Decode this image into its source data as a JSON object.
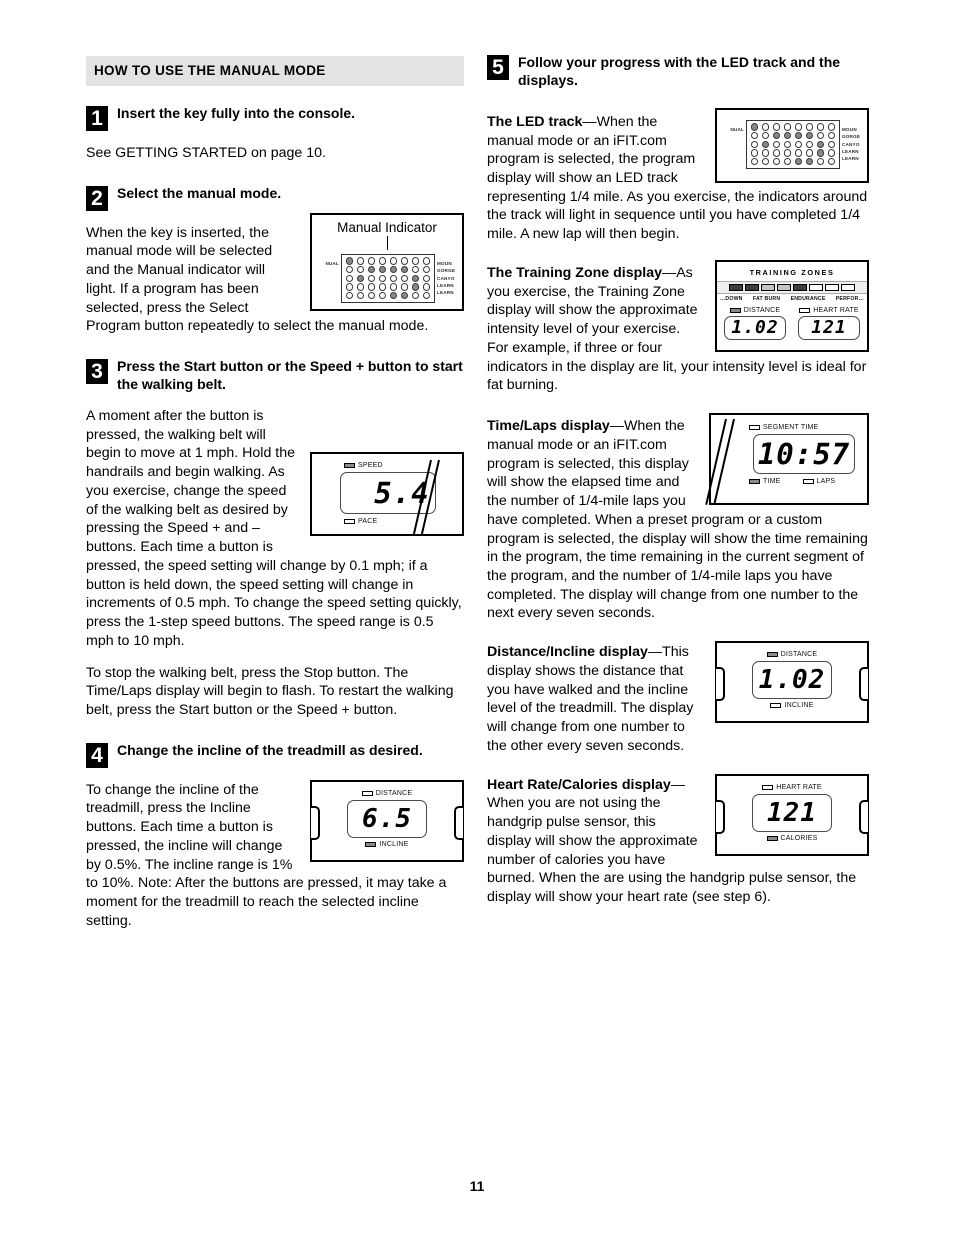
{
  "page": {
    "number": "11"
  },
  "left": {
    "section_header": "HOW TO USE THE MANUAL MODE",
    "steps": [
      {
        "num": "1",
        "title": "Insert the key fully into the console.",
        "paragraphs": [
          "See GETTING STARTED on page 10."
        ]
      },
      {
        "num": "2",
        "title": "Select the manual mode.",
        "paragraphs": [
          "When the key is inserted, the manual mode will be selected and the Manual indicator will light. If a program has been selected, press the Select Program button repeatedly to select the manual mode."
        ]
      },
      {
        "num": "3",
        "title": "Press the Start button or the Speed + button to start the walking belt.",
        "paragraphs": [
          "A moment after the button is pressed, the walking belt will begin to move at 1 mph. Hold the handrails and begin walking. As you exercise, change the speed of the walking belt as desired by pressing the Speed + and – buttons. Each time a button is pressed, the speed setting will change by 0.1 mph; if a button is held down, the speed setting will change in increments of 0.5 mph. To change the speed setting quickly, press the 1-step speed buttons. The speed range is 0.5 mph to 10 mph.",
          "To stop the walking belt, press the Stop button. The Time/Laps display will begin to flash. To restart the walking belt, press the Start button or the Speed + button."
        ]
      },
      {
        "num": "4",
        "title": "Change the incline of the treadmill as desired.",
        "paragraphs": [
          "To change the incline of the treadmill, press the Incline buttons. Each time a button is pressed, the incline will change by 0.5%. The incline range is 1% to 10%. Note: After the buttons are pressed, it may take a moment for the treadmill to reach the selected incline setting."
        ]
      }
    ]
  },
  "right": {
    "step": {
      "num": "5",
      "title": "Follow your progress with the LED track and the displays."
    },
    "blocks": [
      {
        "lead": "The LED track",
        "dash": "—",
        "text": "When the manual mode or an iFIT.com program is selected, the program display will show an LED track representing 1/4 mile. As you exercise, the indicators around the track will light in sequence until you have completed 1/4 mile. A new lap will then begin."
      },
      {
        "lead": "The Training Zone display",
        "dash": "—",
        "text": "As you exercise, the Training Zone display will show the approximate intensity level of your exercise. For example, if three or four indicators in the display are lit, your intensity level is ideal for fat burning."
      },
      {
        "lead": "Time/Laps display",
        "dash": "—",
        "text": "When the manual mode or an iFIT.com program is selected, this display will show the elapsed time and the number of 1/4-mile laps you have completed. When a preset program or a custom program is selected, the display will show the time remaining in the program, the time remaining in the current segment of the program, and the number of 1/4-mile laps you have completed. The display will change from one number to the next every seven seconds."
      },
      {
        "lead": "Distance/Incline display",
        "dash": "—",
        "text": "This display shows the distance that you have walked and the incline level of the treadmill. The display will change from one number to the other every seven seconds."
      },
      {
        "lead": "Heart Rate/Calories display",
        "dash": "—",
        "text": "When you are not using the handgrip pulse sensor, this display will show the approximate number of calories you have burned. When the are using the handgrip pulse sensor, the display will show your heart rate (see step 6)."
      }
    ]
  },
  "figures": {
    "led_track": {
      "caption": "Manual Indicator",
      "left_labels": [
        "NUAL",
        "",
        "",
        "",
        ""
      ],
      "right_labels": [
        "MOUN",
        "GORGE",
        "CANYO",
        "LEARN",
        "LEARN"
      ],
      "rows": 5,
      "cols": 8,
      "lit": [
        [
          1,
          0,
          0,
          0,
          0,
          0,
          0,
          0
        ],
        [
          0,
          0,
          1,
          1,
          1,
          1,
          0,
          0
        ],
        [
          0,
          1,
          0,
          0,
          0,
          0,
          1,
          0
        ],
        [
          0,
          0,
          0,
          0,
          0,
          0,
          1,
          0
        ],
        [
          0,
          0,
          0,
          0,
          1,
          1,
          0,
          0
        ]
      ]
    },
    "led_track_2": {
      "left_labels": [
        "NUAL",
        "",
        "",
        "",
        ""
      ],
      "right_labels": [
        "MOUN",
        "GORGE",
        "CANYO",
        "LEARN",
        "LEARN"
      ],
      "rows": 5,
      "cols": 8,
      "lit": [
        [
          1,
          0,
          0,
          0,
          0,
          0,
          0,
          0
        ],
        [
          0,
          0,
          1,
          1,
          1,
          1,
          0,
          0
        ],
        [
          0,
          1,
          0,
          0,
          0,
          0,
          1,
          0
        ],
        [
          0,
          0,
          0,
          0,
          0,
          0,
          1,
          0
        ],
        [
          0,
          0,
          0,
          0,
          1,
          1,
          0,
          0
        ]
      ]
    },
    "speed": {
      "value": "5.4",
      "indicators": [
        {
          "label": "SPEED",
          "on": true
        },
        {
          "label": "PACE",
          "on": false
        }
      ]
    },
    "incline": {
      "value": "6.5",
      "indicators": [
        {
          "label": "DISTANCE",
          "on": false
        },
        {
          "label": "INCLINE",
          "on": true
        }
      ]
    },
    "distance": {
      "value": "1.02",
      "indicators": [
        {
          "label": "DISTANCE",
          "on": true
        },
        {
          "label": "INCLINE",
          "on": false
        }
      ]
    },
    "heart_rate": {
      "value": "121",
      "indicators": [
        {
          "label": "HEART RATE",
          "on": false
        },
        {
          "label": "CALORIES",
          "on": true
        }
      ]
    },
    "training_zones": {
      "title": "TRAINING ZONES",
      "bars": [
        "dark",
        "dark",
        "mid",
        "mid",
        "dark",
        "off",
        "off",
        "off"
      ],
      "zone_labels": [
        "…DOWN",
        "FAT BURN",
        "ENDURANCE",
        "PERFOR…"
      ],
      "distance": {
        "label": "DISTANCE",
        "on": true,
        "value": "1.02"
      },
      "heart_rate": {
        "label": "HEART RATE",
        "on": false,
        "value": "121"
      }
    },
    "time_laps": {
      "top_indicator": {
        "label": "SEGMENT TIME",
        "on": false
      },
      "value": "10:57",
      "indicators": [
        {
          "label": "TIME",
          "on": true
        },
        {
          "label": "LAPS",
          "on": false
        }
      ]
    }
  }
}
